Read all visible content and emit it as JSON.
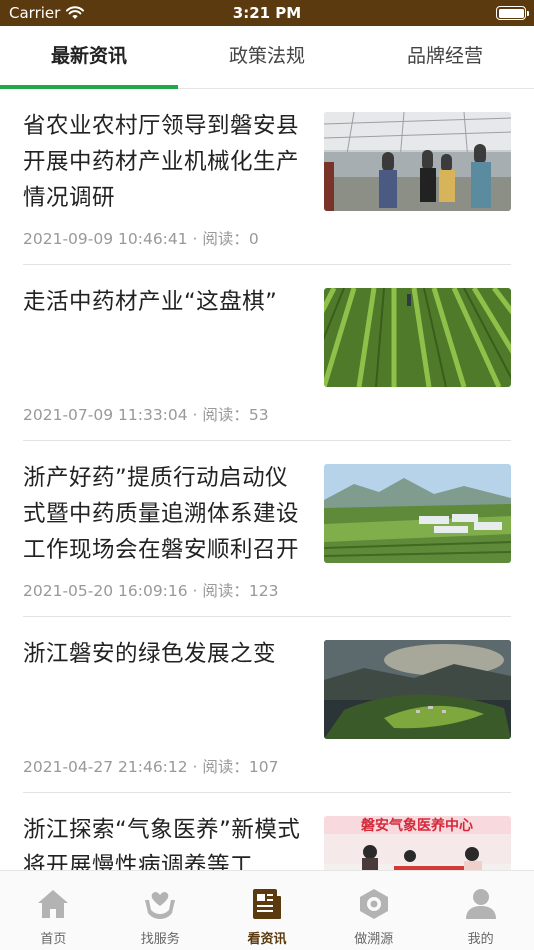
{
  "status_bar": {
    "carrier": "Carrier",
    "time": "3:21 PM"
  },
  "tabs": [
    {
      "label": "最新资讯",
      "active": true
    },
    {
      "label": "政策法规",
      "active": false
    },
    {
      "label": "品牌经营",
      "active": false
    }
  ],
  "news": [
    {
      "title": "省农业农村厅领导到磐安县开展中药材产业机械化生产情况调研",
      "meta": "2021-09-09 10:46:41 · 阅读：0",
      "image": "greenhouse-visit-photo"
    },
    {
      "title": "走活中药材产业“这盘棋”",
      "meta": "2021-07-09 11:33:04 · 阅读：53",
      "image": "crop-field-photo"
    },
    {
      "title": "浙产好药”提质行动启动仪式暨中药质量追溯体系建设工作现场会在磐安顺利召开",
      "meta": "2021-05-20 16:09:16 · 阅读：123",
      "image": "valley-farmland-photo"
    },
    {
      "title": "浙江磐安的绿色发展之变",
      "meta": "2021-04-27 21:46:12 · 阅读：107",
      "image": "mountain-village-photo"
    },
    {
      "title": "浙江探索“气象医养”新模式 将开展慢性病调养等工",
      "meta": "",
      "image": "banner-event-photo",
      "image_text": "磐安气象医养中心"
    }
  ],
  "tabbar": [
    {
      "label": "首页",
      "icon": "home-icon",
      "active": false
    },
    {
      "label": "找服务",
      "icon": "service-heart-icon",
      "active": false
    },
    {
      "label": "看资讯",
      "icon": "news-icon",
      "active": true
    },
    {
      "label": "做溯源",
      "icon": "trace-icon",
      "active": false
    },
    {
      "label": "我的",
      "icon": "profile-icon",
      "active": false
    }
  ],
  "colors": {
    "status_bar": "#5c3a0f",
    "tab_indicator": "#21a84a",
    "tabbar_active": "#5c3a0f",
    "tabbar_inactive": "#b3b3b3"
  }
}
